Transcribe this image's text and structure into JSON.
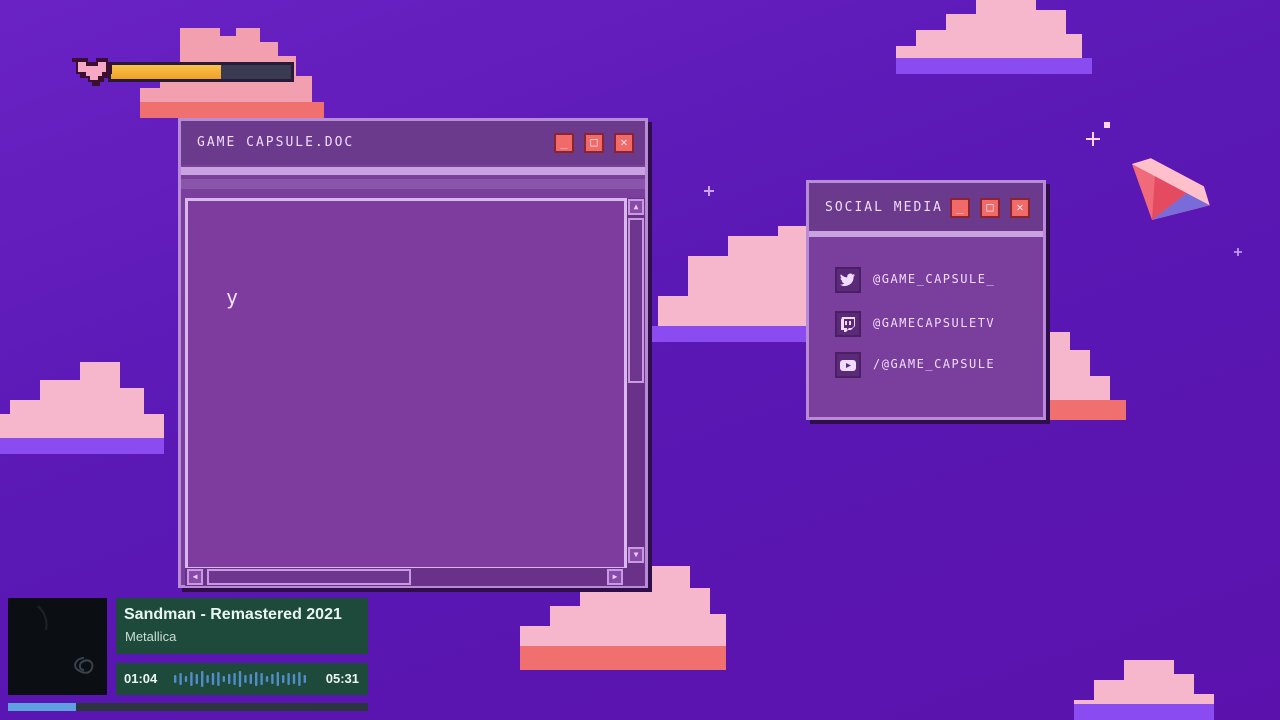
{
  "health_bar": {
    "level_percent": 61
  },
  "document_window": {
    "title": "GAME CAPSULE.DOC",
    "body_text": "y",
    "buttons": {
      "minimize": "_",
      "maximize": "□",
      "close": "✕"
    }
  },
  "social_window": {
    "title": "SOCIAL MEDIA",
    "links": [
      {
        "icon": "twitter-icon",
        "label": "@GAME_CAPSULE_"
      },
      {
        "icon": "twitch-icon",
        "label": "@GAMECAPSULETV"
      },
      {
        "icon": "youtube-icon",
        "label": "/@GAME_CAPSULE"
      }
    ]
  },
  "now_playing": {
    "title": "Sandman - Remastered 2021",
    "artist": "Metallica",
    "elapsed": "01:04",
    "duration": "05:31",
    "progress_fraction": 0.19
  },
  "colors": {
    "background": "#5a18b4",
    "window": "#7a3e9c",
    "accent": "#f06a6a",
    "music_panel": "#1e4a3c"
  }
}
